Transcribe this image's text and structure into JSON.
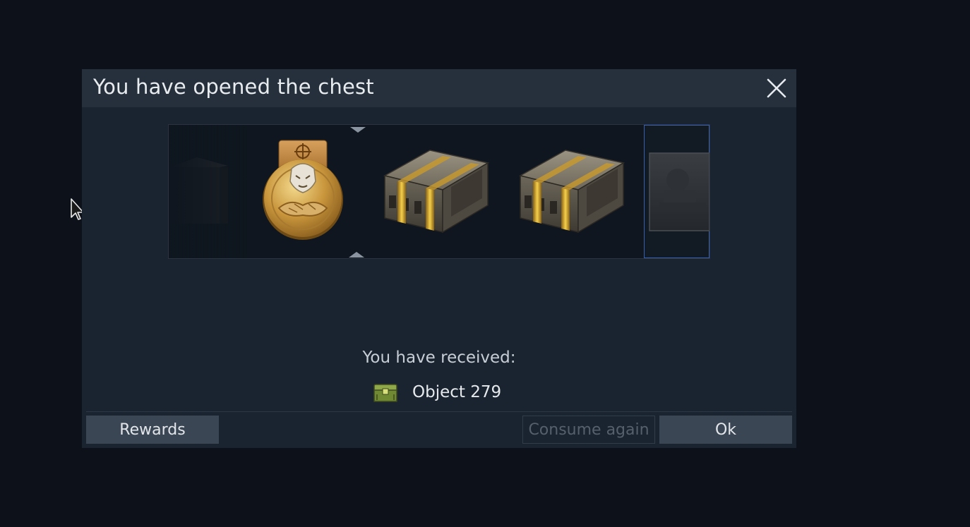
{
  "dialog": {
    "title": "You have opened the chest",
    "close_icon": "close-icon"
  },
  "roulette": {
    "items": [
      {
        "name": "chest-icon",
        "state": "faded"
      },
      {
        "name": "medal-icon",
        "state": "normal"
      },
      {
        "name": "chest-icon",
        "state": "normal"
      },
      {
        "name": "chest-icon",
        "state": "normal"
      },
      {
        "name": "tank-card-icon",
        "state": "selected"
      }
    ]
  },
  "result": {
    "label": "You have received:",
    "item_icon": "small-chest-icon",
    "item_name": "Object 279"
  },
  "buttons": {
    "rewards": "Rewards",
    "consume_again": "Consume again",
    "ok": "Ok"
  },
  "colors": {
    "background": "#0d121a",
    "dialog": "#1a2430",
    "header": "#25303c",
    "button": "#3a4653",
    "selected_border": "#3760b0",
    "gold": "#d9a938"
  }
}
